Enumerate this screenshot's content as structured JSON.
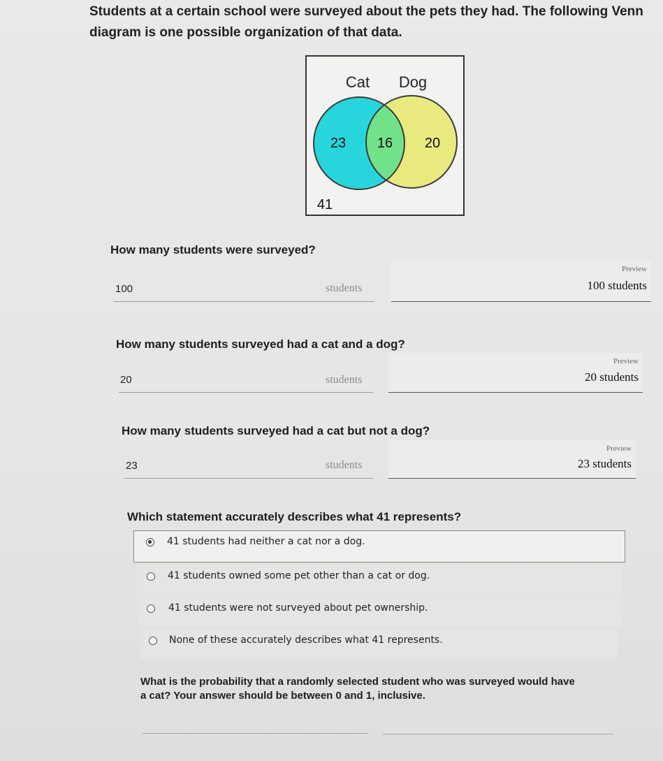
{
  "intro": {
    "line1": "Students at a certain school were surveyed about the pets they had. The following Venn",
    "line2": "diagram is one possible organization of that data."
  },
  "venn": {
    "label_cat": "Cat",
    "label_dog": "Dog",
    "cat_only": "23",
    "both": "16",
    "dog_only": "20",
    "neither": "41",
    "colors": {
      "cat": "#27d6dc",
      "dog": "#e8ea7e",
      "overlap": "#72e28a"
    }
  },
  "q1": {
    "question": "How many students were surveyed?",
    "answer": "100",
    "unit": "students",
    "preview_label": "Preview",
    "preview_value": "100 students"
  },
  "q2": {
    "question": "How many students surveyed had a cat and a dog?",
    "answer": "20",
    "unit": "students",
    "preview_label": "Preview",
    "preview_value": "20 students"
  },
  "q3": {
    "question": "How many students surveyed had a cat but not a dog?",
    "answer": "23",
    "unit": "students",
    "preview_label": "Preview",
    "preview_value": "23 students"
  },
  "q4": {
    "question": "Which statement accurately describes what 41 represents?",
    "options": [
      {
        "label": "41 students had neither a cat nor a dog.",
        "selected": true
      },
      {
        "label": "41 students owned some pet other than a cat or dog.",
        "selected": false
      },
      {
        "label": "41 students were not surveyed about pet ownership.",
        "selected": false
      },
      {
        "label": "None of these accurately describes what 41 represents.",
        "selected": false
      }
    ]
  },
  "q5": {
    "line1": "What is the probability that a randomly selected student who was surveyed would have",
    "line2": "a cat? Your answer should be between 0 and 1, inclusive."
  }
}
